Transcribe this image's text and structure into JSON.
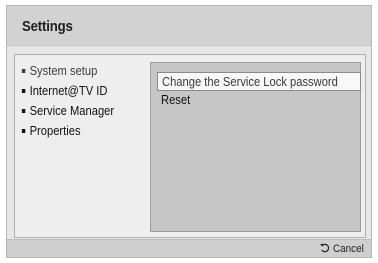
{
  "header": {
    "title": "Settings"
  },
  "menu": {
    "items": [
      {
        "label": "System setup",
        "active": true
      },
      {
        "label": "Internet@TV ID",
        "active": false
      },
      {
        "label": "Service Manager",
        "active": false
      },
      {
        "label": "Properties",
        "active": false
      }
    ]
  },
  "panel": {
    "options": [
      {
        "label": "Change the Service Lock password",
        "selected": true
      },
      {
        "label": "Reset",
        "selected": false
      }
    ]
  },
  "footer": {
    "cancel_label": "Cancel",
    "cancel_icon": "return-icon"
  },
  "colors": {
    "background": "#e6e6e6",
    "title_bar": "#d2d2d2",
    "panel": "#c6c6c6",
    "highlight": "#f8f8f8"
  }
}
